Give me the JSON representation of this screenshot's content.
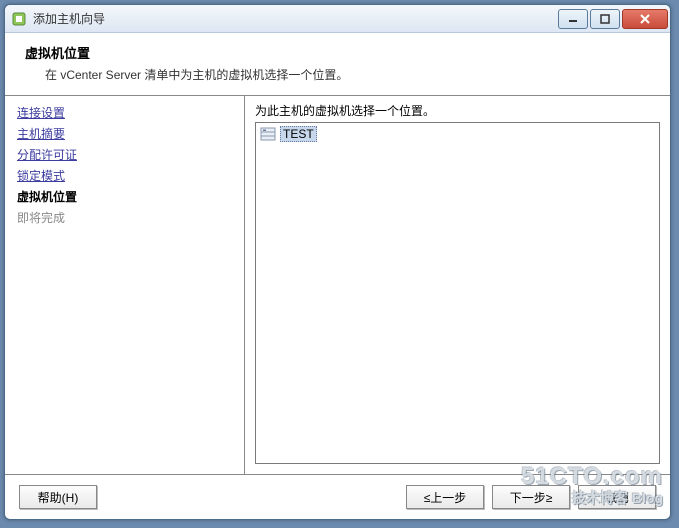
{
  "window": {
    "title": "添加主机向导"
  },
  "header": {
    "title": "虚拟机位置",
    "description": "在 vCenter Server 清单中为主机的虚拟机选择一个位置。"
  },
  "sidebar": {
    "items": [
      {
        "label": "连接设置",
        "state": "visited"
      },
      {
        "label": "主机摘要",
        "state": "visited"
      },
      {
        "label": "分配许可证",
        "state": "visited"
      },
      {
        "label": "锁定模式",
        "state": "visited"
      },
      {
        "label": "虚拟机位置",
        "state": "current"
      },
      {
        "label": "即将完成",
        "state": "pending"
      }
    ]
  },
  "content": {
    "label": "为此主机的虚拟机选择一个位置。",
    "tree": {
      "selected": "TEST"
    }
  },
  "buttons": {
    "help": "帮助(H)",
    "back": "≤上一步",
    "next": "下一步≥",
    "cancel": "取消"
  },
  "watermark": {
    "main": "51CTO.com",
    "sub": "技术博客 Blog"
  }
}
